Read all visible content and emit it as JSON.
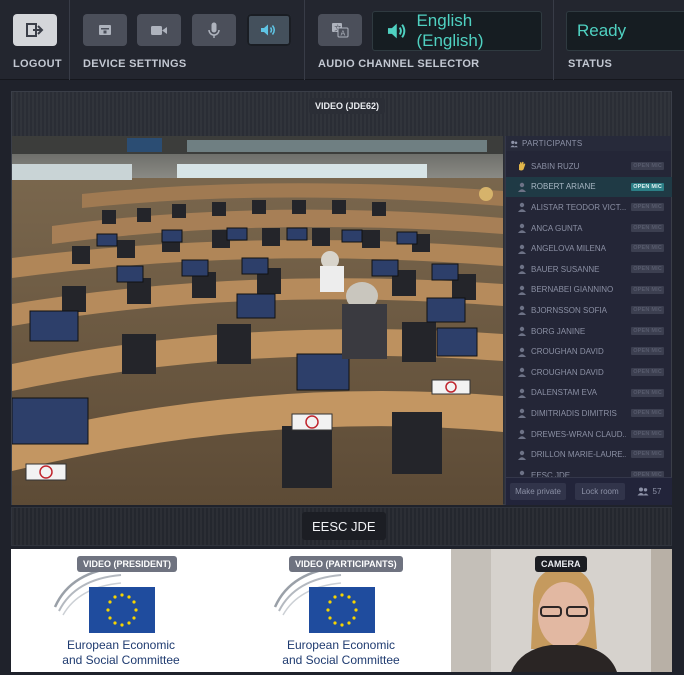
{
  "topbar": {
    "logout_label": "LOGOUT",
    "device_settings_label": "DEVICE SETTINGS",
    "audio_channel_label": "AUDIO CHANNEL SELECTOR",
    "status_label": "STATUS",
    "language_value": "English (English)",
    "status_value": "Ready",
    "buttons": [
      {
        "icon": "logout-icon"
      },
      {
        "icon": "window-icon"
      },
      {
        "icon": "camera-icon"
      },
      {
        "icon": "microphone-icon"
      },
      {
        "icon": "speaker-icon"
      },
      {
        "icon": "translate-icon"
      }
    ]
  },
  "main_video": {
    "label": "VIDEO (JDE62)"
  },
  "participants": {
    "header": "PARTICIPANTS",
    "items": [
      {
        "name": "SABIN RUZU",
        "tag": "OPEN MIC",
        "icon": "raised-hand-icon"
      },
      {
        "name": "ROBERT ARIANE",
        "tag": "OPEN MIC",
        "selected": true
      },
      {
        "name": "ALISTAR TEODOR VICT...",
        "tag": "OPEN MIC"
      },
      {
        "name": "ANCA GUNTA",
        "tag": "OPEN MIC"
      },
      {
        "name": "ANGELOVA MILENA",
        "tag": "OPEN MIC"
      },
      {
        "name": "BAUER SUSANNE",
        "tag": "OPEN MIC"
      },
      {
        "name": "BERNABEI GIANNINO",
        "tag": "OPEN MIC"
      },
      {
        "name": "BJORNSSON SOFIA",
        "tag": "OPEN MIC"
      },
      {
        "name": "BORG JANINE",
        "tag": "OPEN MIC"
      },
      {
        "name": "CROUGHAN DAVID",
        "tag": "OPEN MIC"
      },
      {
        "name": "CROUGHAN DAVID",
        "tag": "OPEN MIC"
      },
      {
        "name": "DALENSTAM EVA",
        "tag": "OPEN MIC"
      },
      {
        "name": "DIMITRIADIS DIMITRIS",
        "tag": "OPEN MIC"
      },
      {
        "name": "DREWES-WRAN CLAUD...",
        "tag": "OPEN MIC"
      },
      {
        "name": "DRILLON MARIE-LAURE...",
        "tag": "OPEN MIC"
      },
      {
        "name": "EESC JDE",
        "tag": "OPEN MIC"
      }
    ],
    "make_private_label": "Make private",
    "lock_room_label": "Lock room",
    "count": "57"
  },
  "room": {
    "title": "EESC JDE"
  },
  "tiles": {
    "president_label": "VIDEO (PRESIDENT)",
    "participants_label": "VIDEO (PARTICIPANTS)",
    "camera_label": "CAMERA",
    "org_line1": "European Economic",
    "org_line2": "and Social Committee"
  },
  "colors": {
    "accent": "#4fd1c1",
    "eu_blue": "#1f4c9e",
    "eu_star": "#f6d400",
    "selected_row": "#1f3a45"
  }
}
